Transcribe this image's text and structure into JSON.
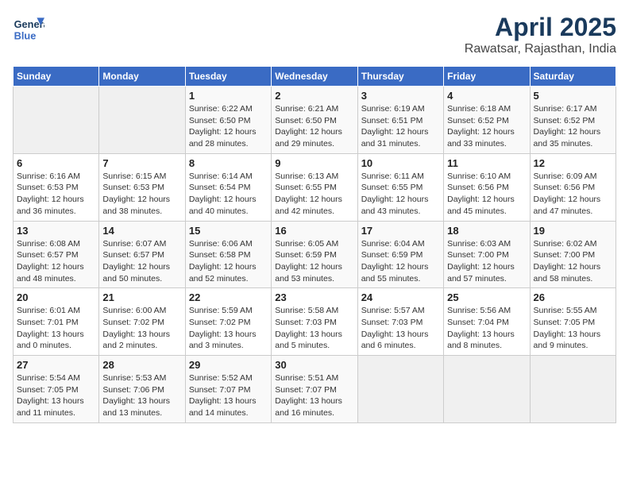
{
  "header": {
    "logo_text_top": "General",
    "logo_text_bottom": "Blue",
    "title": "April 2025",
    "subtitle": "Rawatsar, Rajasthan, India"
  },
  "weekdays": [
    "Sunday",
    "Monday",
    "Tuesday",
    "Wednesday",
    "Thursday",
    "Friday",
    "Saturday"
  ],
  "weeks": [
    [
      {
        "day": "",
        "info": ""
      },
      {
        "day": "",
        "info": ""
      },
      {
        "day": "1",
        "info": "Sunrise: 6:22 AM\nSunset: 6:50 PM\nDaylight: 12 hours\nand 28 minutes."
      },
      {
        "day": "2",
        "info": "Sunrise: 6:21 AM\nSunset: 6:50 PM\nDaylight: 12 hours\nand 29 minutes."
      },
      {
        "day": "3",
        "info": "Sunrise: 6:19 AM\nSunset: 6:51 PM\nDaylight: 12 hours\nand 31 minutes."
      },
      {
        "day": "4",
        "info": "Sunrise: 6:18 AM\nSunset: 6:52 PM\nDaylight: 12 hours\nand 33 minutes."
      },
      {
        "day": "5",
        "info": "Sunrise: 6:17 AM\nSunset: 6:52 PM\nDaylight: 12 hours\nand 35 minutes."
      }
    ],
    [
      {
        "day": "6",
        "info": "Sunrise: 6:16 AM\nSunset: 6:53 PM\nDaylight: 12 hours\nand 36 minutes."
      },
      {
        "day": "7",
        "info": "Sunrise: 6:15 AM\nSunset: 6:53 PM\nDaylight: 12 hours\nand 38 minutes."
      },
      {
        "day": "8",
        "info": "Sunrise: 6:14 AM\nSunset: 6:54 PM\nDaylight: 12 hours\nand 40 minutes."
      },
      {
        "day": "9",
        "info": "Sunrise: 6:13 AM\nSunset: 6:55 PM\nDaylight: 12 hours\nand 42 minutes."
      },
      {
        "day": "10",
        "info": "Sunrise: 6:11 AM\nSunset: 6:55 PM\nDaylight: 12 hours\nand 43 minutes."
      },
      {
        "day": "11",
        "info": "Sunrise: 6:10 AM\nSunset: 6:56 PM\nDaylight: 12 hours\nand 45 minutes."
      },
      {
        "day": "12",
        "info": "Sunrise: 6:09 AM\nSunset: 6:56 PM\nDaylight: 12 hours\nand 47 minutes."
      }
    ],
    [
      {
        "day": "13",
        "info": "Sunrise: 6:08 AM\nSunset: 6:57 PM\nDaylight: 12 hours\nand 48 minutes."
      },
      {
        "day": "14",
        "info": "Sunrise: 6:07 AM\nSunset: 6:57 PM\nDaylight: 12 hours\nand 50 minutes."
      },
      {
        "day": "15",
        "info": "Sunrise: 6:06 AM\nSunset: 6:58 PM\nDaylight: 12 hours\nand 52 minutes."
      },
      {
        "day": "16",
        "info": "Sunrise: 6:05 AM\nSunset: 6:59 PM\nDaylight: 12 hours\nand 53 minutes."
      },
      {
        "day": "17",
        "info": "Sunrise: 6:04 AM\nSunset: 6:59 PM\nDaylight: 12 hours\nand 55 minutes."
      },
      {
        "day": "18",
        "info": "Sunrise: 6:03 AM\nSunset: 7:00 PM\nDaylight: 12 hours\nand 57 minutes."
      },
      {
        "day": "19",
        "info": "Sunrise: 6:02 AM\nSunset: 7:00 PM\nDaylight: 12 hours\nand 58 minutes."
      }
    ],
    [
      {
        "day": "20",
        "info": "Sunrise: 6:01 AM\nSunset: 7:01 PM\nDaylight: 13 hours\nand 0 minutes."
      },
      {
        "day": "21",
        "info": "Sunrise: 6:00 AM\nSunset: 7:02 PM\nDaylight: 13 hours\nand 2 minutes."
      },
      {
        "day": "22",
        "info": "Sunrise: 5:59 AM\nSunset: 7:02 PM\nDaylight: 13 hours\nand 3 minutes."
      },
      {
        "day": "23",
        "info": "Sunrise: 5:58 AM\nSunset: 7:03 PM\nDaylight: 13 hours\nand 5 minutes."
      },
      {
        "day": "24",
        "info": "Sunrise: 5:57 AM\nSunset: 7:03 PM\nDaylight: 13 hours\nand 6 minutes."
      },
      {
        "day": "25",
        "info": "Sunrise: 5:56 AM\nSunset: 7:04 PM\nDaylight: 13 hours\nand 8 minutes."
      },
      {
        "day": "26",
        "info": "Sunrise: 5:55 AM\nSunset: 7:05 PM\nDaylight: 13 hours\nand 9 minutes."
      }
    ],
    [
      {
        "day": "27",
        "info": "Sunrise: 5:54 AM\nSunset: 7:05 PM\nDaylight: 13 hours\nand 11 minutes."
      },
      {
        "day": "28",
        "info": "Sunrise: 5:53 AM\nSunset: 7:06 PM\nDaylight: 13 hours\nand 13 minutes."
      },
      {
        "day": "29",
        "info": "Sunrise: 5:52 AM\nSunset: 7:07 PM\nDaylight: 13 hours\nand 14 minutes."
      },
      {
        "day": "30",
        "info": "Sunrise: 5:51 AM\nSunset: 7:07 PM\nDaylight: 13 hours\nand 16 minutes."
      },
      {
        "day": "",
        "info": ""
      },
      {
        "day": "",
        "info": ""
      },
      {
        "day": "",
        "info": ""
      }
    ]
  ]
}
